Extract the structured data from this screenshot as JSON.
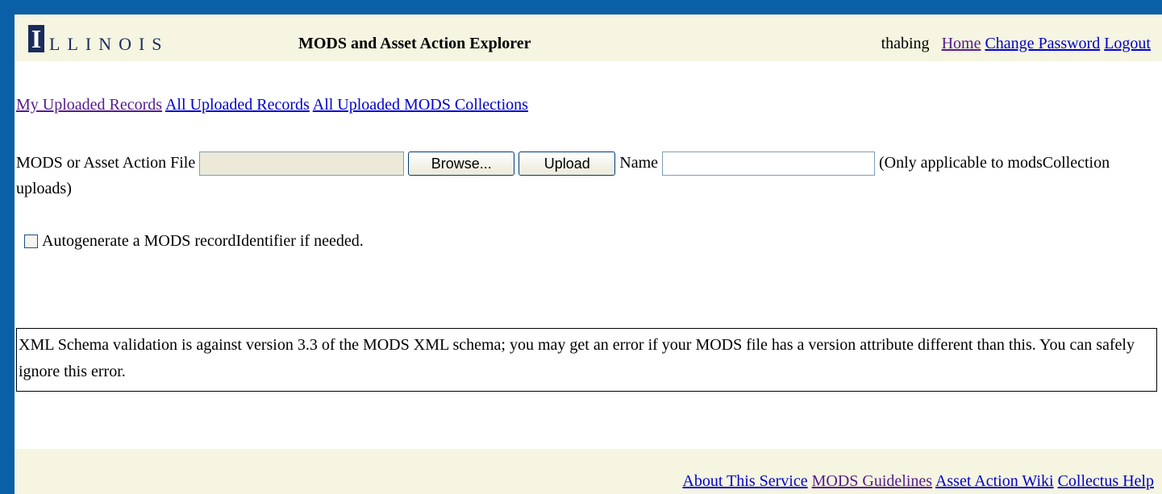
{
  "header": {
    "logo_letter": "I",
    "logo_text": "LLINOIS",
    "app_title": "MODS and Asset Action Explorer",
    "username": "thabing",
    "links": {
      "home": "Home",
      "change_password": "Change Password",
      "logout": "Logout"
    }
  },
  "nav": {
    "my_records": "My Uploaded Records",
    "all_records": "All Uploaded Records",
    "all_collections": "All Uploaded MODS Collections"
  },
  "upload": {
    "file_label": "MODS or Asset Action File",
    "file_value": "",
    "browse_label": "Browse...",
    "upload_label": "Upload",
    "name_label": "Name",
    "name_value": "",
    "name_note": "(Only applicable to modsCollection uploads)",
    "autogenerate_label": "Autogenerate a MODS recordIdentifier if needed.",
    "autogenerate_checked": false
  },
  "notice": {
    "text": "XML Schema validation is against version 3.3 of the MODS XML schema; you may get an error if your MODS file has a version attribute different than this. You can safely ignore this error."
  },
  "footer": {
    "about": "About This Service",
    "guidelines": "MODS Guidelines",
    "wiki": "Asset Action Wiki",
    "help": "Collectus Help"
  },
  "colors": {
    "page_border": "#0a5fa6",
    "band": "#f5f5e1",
    "link": "#0000cc",
    "visited_link": "#551a8b",
    "logo": "#1a2b5c"
  }
}
